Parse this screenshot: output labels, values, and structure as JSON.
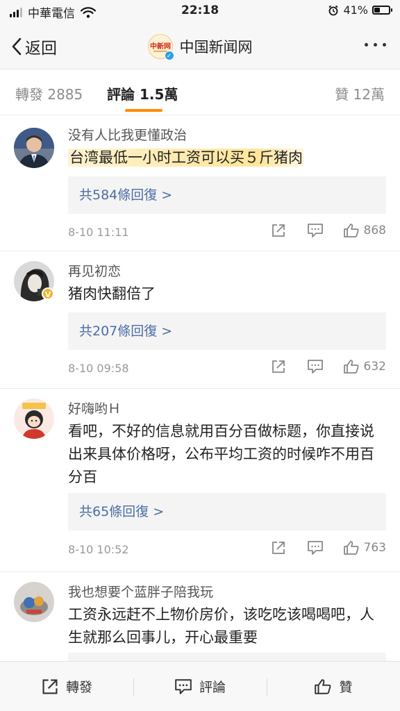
{
  "status_bar": {
    "carrier": "中華電信",
    "time": "22:18",
    "battery": "41%",
    "battery_level": 0.41
  },
  "nav": {
    "back_label": "返回",
    "title": "中国新闻网",
    "logo_text": "中新网"
  },
  "tabs": {
    "forward": "轉發 2885",
    "comments": "評論 1.5萬",
    "likes": "贊 12萬"
  },
  "comments": [
    {
      "username": "没有人比我更懂政治",
      "text": "台湾最低一小时工资可以买５斤猪肉",
      "replies": "共584條回復 >",
      "time": "8-10 11:11",
      "likes": "868"
    },
    {
      "username": "再见初恋",
      "text": "猪肉快翻倍了",
      "replies": "共207條回復 >",
      "time": "8-10 09:58",
      "likes": "632"
    },
    {
      "username": "好嗨哟Ｈ",
      "text": "看吧，不好的信息就用百分百做标题，你直接说出来具体价格呀，公布平均工资的时候咋不用百分百",
      "replies": "共65條回復 >",
      "time": "8-10 10:52",
      "likes": "763"
    },
    {
      "username": "我也想要个蓝胖子陪我玩",
      "text": "工资永远赶不上物价房价，该吃吃该喝喝吧，人生就那么回事儿，开心最重要"
    }
  ],
  "bottom_bar": {
    "forward": "轉發",
    "comment": "評論",
    "like": "贊"
  },
  "colors": {
    "accent": "#ff8a00",
    "link": "#4b6da6",
    "verified_blue": "#2e9fe6",
    "verified_gold": "#f3b22a"
  }
}
